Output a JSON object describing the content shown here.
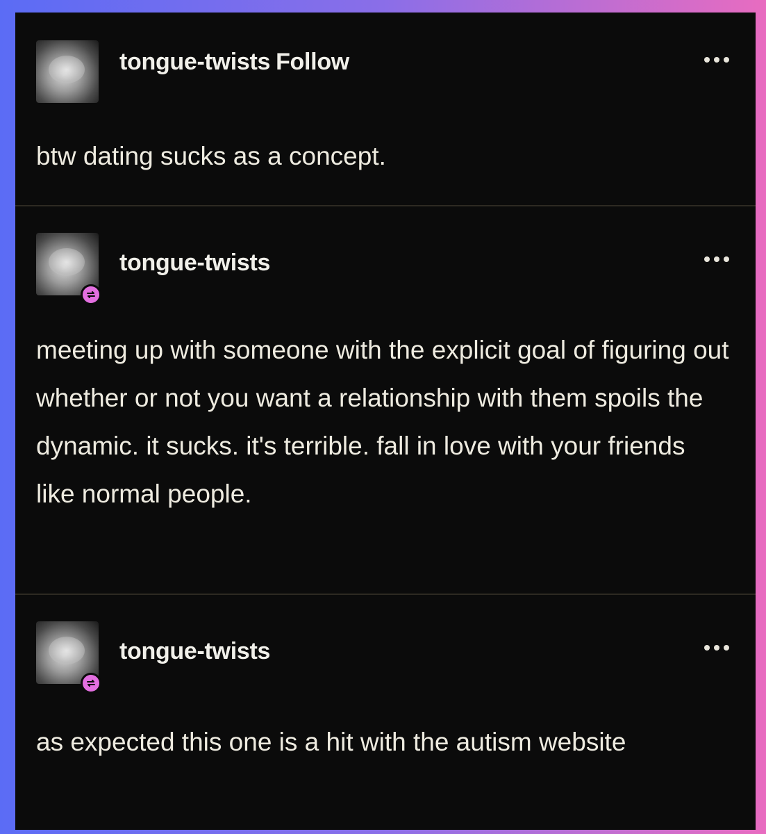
{
  "posts": [
    {
      "username": "tongue-twists",
      "follow_label": "Follow",
      "is_reblog": false,
      "text": "btw dating sucks as a concept.",
      "avatar_icon": "avatar-image",
      "menu_icon": "more-options-icon"
    },
    {
      "username": "tongue-twists",
      "is_reblog": true,
      "text": "meeting up with someone with the explicit goal of figuring out whether or not you want a relationship with them spoils the dynamic. it sucks. it's terrible. fall in love with your friends like normal people.",
      "avatar_icon": "avatar-image",
      "badge_icon": "reblog-icon",
      "menu_icon": "more-options-icon"
    },
    {
      "username": "tongue-twists",
      "is_reblog": true,
      "text": "as expected this one is a hit with the autism website",
      "avatar_icon": "avatar-image",
      "badge_icon": "reblog-icon",
      "menu_icon": "more-options-icon"
    }
  ],
  "colors": {
    "background_gradient_start": "#5b6cf5",
    "background_gradient_end": "#e86cc0",
    "card_background": "#0b0b0b",
    "text": "#eeebe0",
    "reblog_badge": "#e36fe0"
  }
}
